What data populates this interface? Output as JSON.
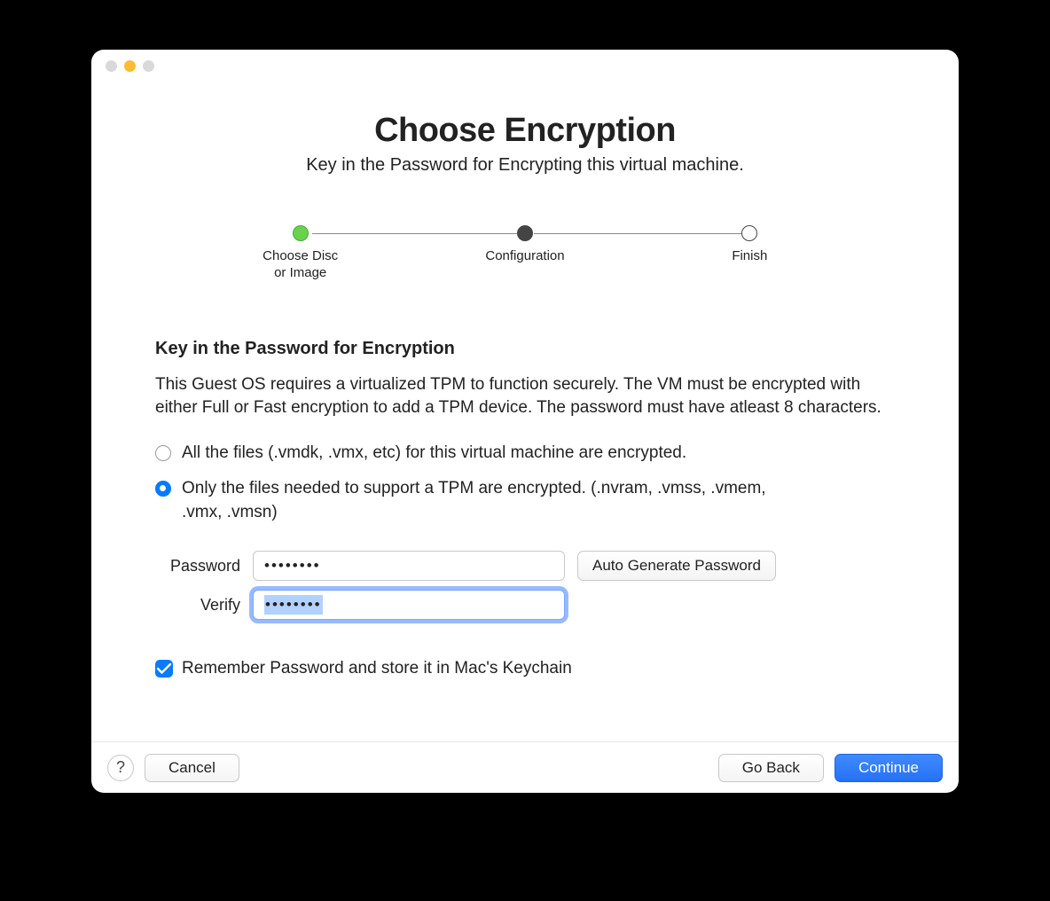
{
  "heading": {
    "title": "Choose Encryption",
    "subtitle": "Key in the Password for Encrypting this virtual machine."
  },
  "steps": [
    {
      "label": "Choose Disc\nor Image",
      "state": "done"
    },
    {
      "label": "Configuration",
      "state": "current"
    },
    {
      "label": "Finish",
      "state": ""
    }
  ],
  "section": {
    "heading": "Key in the Password for Encryption",
    "description": "This Guest OS requires a virtualized TPM to function securely. The VM must be encrypted with either Full or Fast encryption to add a TPM device. The password must have atleast 8 characters."
  },
  "options": {
    "full": "All the files (.vmdk, .vmx, etc) for this virtual machine are encrypted.",
    "fast": "Only the files needed to support a TPM are encrypted. (.nvram, .vmss, .vmem, .vmx, .vmsn)",
    "selected": "fast"
  },
  "fields": {
    "password_label": "Password",
    "password_value": "••••••••",
    "verify_label": "Verify",
    "verify_value": "••••••••",
    "auto_generate": "Auto Generate Password"
  },
  "remember": {
    "label": "Remember Password and store it in Mac's Keychain",
    "checked": true
  },
  "footer": {
    "help": "?",
    "cancel": "Cancel",
    "back": "Go Back",
    "continue": "Continue"
  }
}
